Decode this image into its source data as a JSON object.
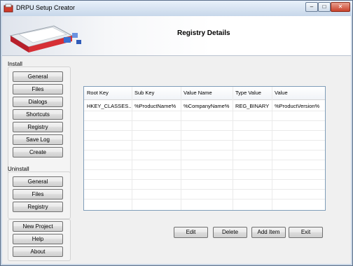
{
  "window": {
    "title": "DRPU Setup Creator",
    "controls": {
      "minimize": "–",
      "maximize": "□",
      "close": "✕"
    }
  },
  "header": {
    "title": "Registry Details"
  },
  "install": {
    "label": "Install",
    "buttons": [
      "General",
      "Files",
      "Dialogs",
      "Shortcuts",
      "Registry",
      "Save Log",
      "Create"
    ]
  },
  "uninstall": {
    "label": "Uninstall",
    "buttons": [
      "General",
      "Files",
      "Registry"
    ]
  },
  "misc": {
    "buttons": [
      "New Project",
      "Help",
      "About"
    ]
  },
  "table": {
    "columns": [
      "Root Key",
      "Sub Key",
      "Value Name",
      "Type Value",
      "Value"
    ],
    "rows": [
      [
        "HKEY_CLASSES...",
        "%ProductName%",
        "%CompanyName%",
        "REG_BINARY",
        "%ProductVersion%"
      ]
    ]
  },
  "actions": {
    "edit": "Edit",
    "delete": "Delete",
    "add_item": "Add Item",
    "exit": "Exit"
  }
}
